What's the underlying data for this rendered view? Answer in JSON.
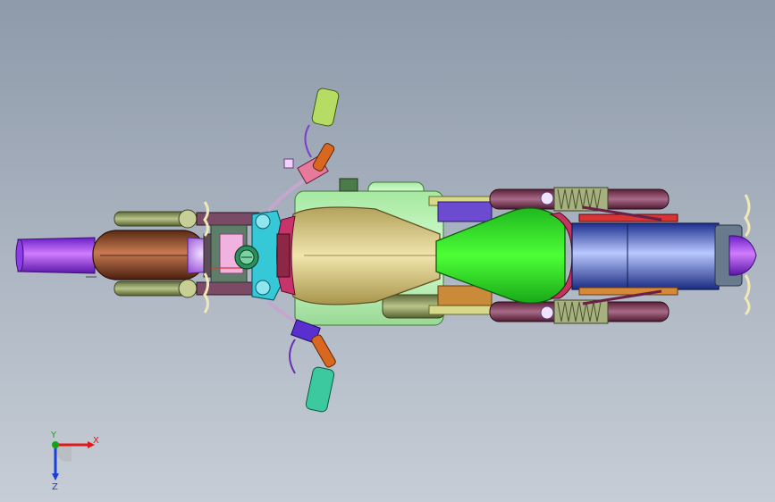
{
  "viewport": {
    "background_top": "#8e9aaa",
    "background_bottom": "#c6cdd6"
  },
  "model": {
    "component": "motorcycle-assembly-top-view"
  },
  "triad": {
    "x_label": "X",
    "y_label": "Y",
    "z_label": "Z",
    "x_color": "#e01818",
    "y_color": "#17a317",
    "z_color": "#1a3fd6"
  }
}
